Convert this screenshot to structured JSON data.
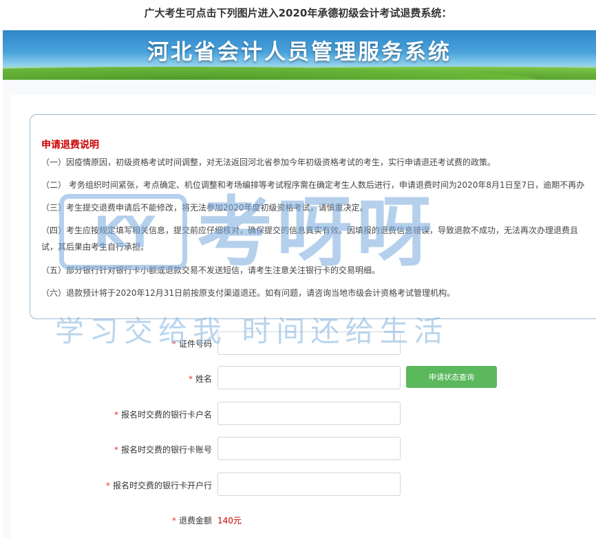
{
  "page": {
    "heading": "广大考生可点击下列图片进入2020年承德初级会计考试退费系统："
  },
  "banner": {
    "title": "河北省会计人员管理服务系统"
  },
  "notice": {
    "title": "申请退费说明",
    "items": [
      "（一）因疫情原因，初级资格考试时间调整，对无法返回河北省参加今年初级资格考试的考生，实行申请退还考试费的政策。",
      "（二） 考务组织时间紧张，考点确定、机位调整和考场编排等考试程序需在确定考生人数后进行，申请退费时间为2020年8月1日至7日，逾期不再办",
      "（三）考生提交退费申请后不能修改，将无法参加2020年度初级资格考试，请慎重决定。",
      "（四）考生应按规定填写相关信息，提交前应仔细核对，确保提交的信息真实有效。因填报的退费信息错误，导致退款不成功，无法再次办理退费且",
      "试，其后果由考生自行承担。",
      "（五）部分银行针对银行卡小额或退款交易不发送短信，请考生注意关注银行卡的交易明细。",
      "（六）退款预计将于2020年12月31日前按原支付渠道退还。如有问题，请咨询当地市级会计资格考试管理机构。"
    ]
  },
  "form": {
    "required_mark": "*",
    "id_label": "证件号码",
    "name_label": "姓名",
    "query_button": "申请状态查询",
    "card_holder_label": "报名时交费的银行卡户名",
    "card_number_label": "报名时交费的银行卡账号",
    "card_bank_label": "报名时交费的银行卡开户行",
    "fee_label": "退费金额",
    "fee_value": "140元"
  },
  "watermark": {
    "logo": "KY",
    "brand": "考呀呀",
    "slogan": "学习交给我  时间还给生活"
  },
  "colors": {
    "accent_red": "#cc0000",
    "button_green": "#5cb85c",
    "banner_blue": "#2f86c9"
  }
}
